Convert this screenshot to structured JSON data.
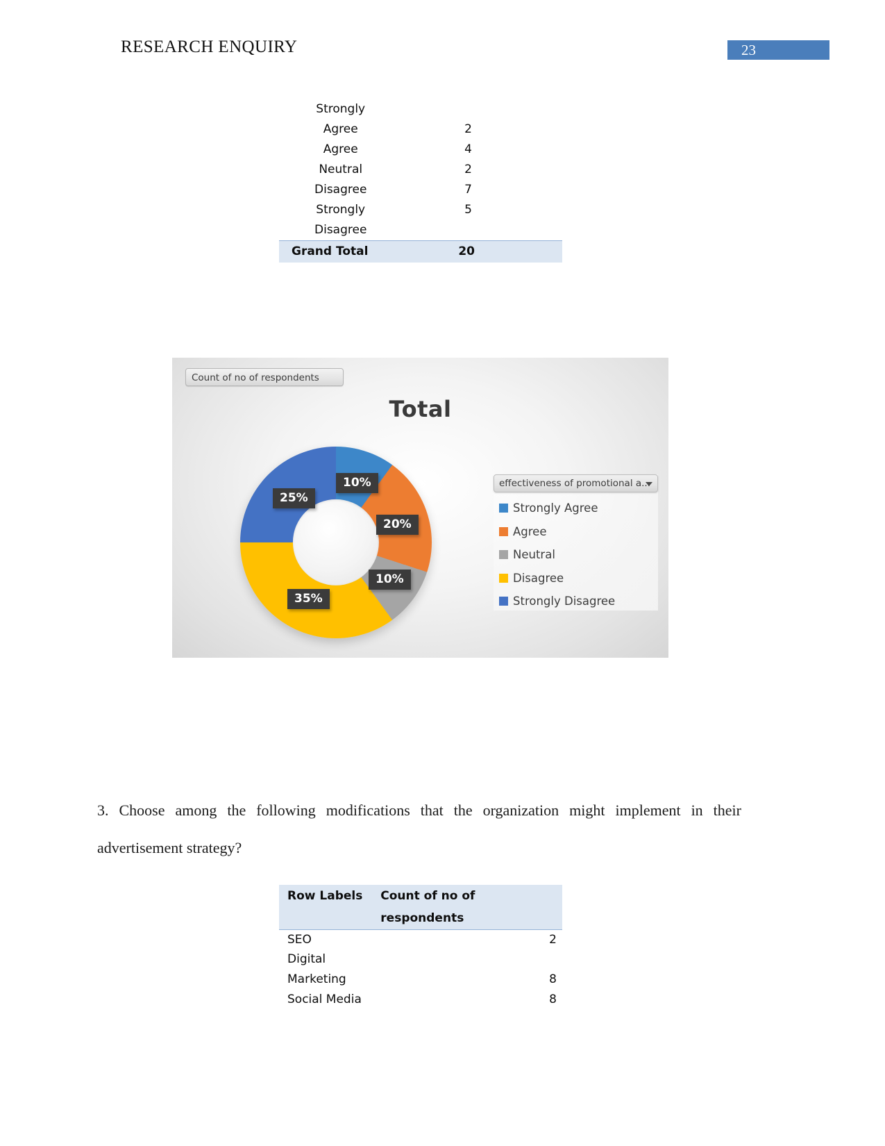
{
  "header": {
    "title": "RESEARCH ENQUIRY",
    "page_number": "23",
    "badge_color": "#4a7ebb"
  },
  "likert_table": {
    "rows": [
      {
        "label_line1": "Strongly",
        "label_line2": "Agree",
        "value": "2"
      },
      {
        "label_line1": "Agree",
        "label_line2": "",
        "value": "4"
      },
      {
        "label_line1": "Neutral",
        "label_line2": "",
        "value": "2"
      },
      {
        "label_line1": "Disagree",
        "label_line2": "",
        "value": "7"
      },
      {
        "label_line1": "Strongly",
        "label_line2": "Disagree",
        "value": "5"
      }
    ],
    "grand_total_label": "Grand Total",
    "grand_total_value": "20",
    "highlight_color": "#dce6f2"
  },
  "chart": {
    "field_button_label": "Count of no of respondents",
    "title": "Total",
    "legend_dropdown_label": "effectiveness of promotional a...",
    "legend": [
      {
        "label": "Strongly Agree",
        "color": "#3d87c9"
      },
      {
        "label": "Agree",
        "color": "#ed7d31"
      },
      {
        "label": "Neutral",
        "color": "#a5a5a5"
      },
      {
        "label": "Disagree",
        "color": "#ffc000"
      },
      {
        "label": "Strongly Disagree",
        "color": "#4472c4"
      }
    ],
    "labels": {
      "strongly_agree": "10%",
      "agree": "20%",
      "neutral": "10%",
      "disagree": "35%",
      "strongly_disagree": "25%"
    }
  },
  "chart_data": {
    "type": "pie",
    "title": "Total",
    "subtitle": "",
    "xlabel": "",
    "ylabel": "",
    "legend_position": "right",
    "legend_title": "effectiveness of promotional a...",
    "value_field": "Count of no of respondents",
    "donut": true,
    "categories": [
      "Strongly Agree",
      "Agree",
      "Neutral",
      "Disagree",
      "Strongly Disagree"
    ],
    "values": [
      2,
      4,
      2,
      7,
      5
    ],
    "percentages": [
      10,
      20,
      10,
      35,
      25
    ],
    "data_labels": [
      "10%",
      "20%",
      "10%",
      "35%",
      "25%"
    ],
    "colors": [
      "#3d87c9",
      "#ed7d31",
      "#a5a5a5",
      "#ffc000",
      "#4472c4"
    ],
    "total": 20
  },
  "question": {
    "text": "3. Choose among the following modifications that the organization might implement in their advertisement strategy?"
  },
  "modifications_table": {
    "header": {
      "row_labels": "Row Labels",
      "count": "Count of no of respondents"
    },
    "rows": [
      {
        "label_line1": "SEO",
        "label_line2": "",
        "value": "2"
      },
      {
        "label_line1": "Digital",
        "label_line2": "Marketing",
        "value": "8"
      },
      {
        "label_line1": "Social Media",
        "label_line2": "",
        "value": "8"
      }
    ],
    "highlight_color": "#dce6f2"
  }
}
